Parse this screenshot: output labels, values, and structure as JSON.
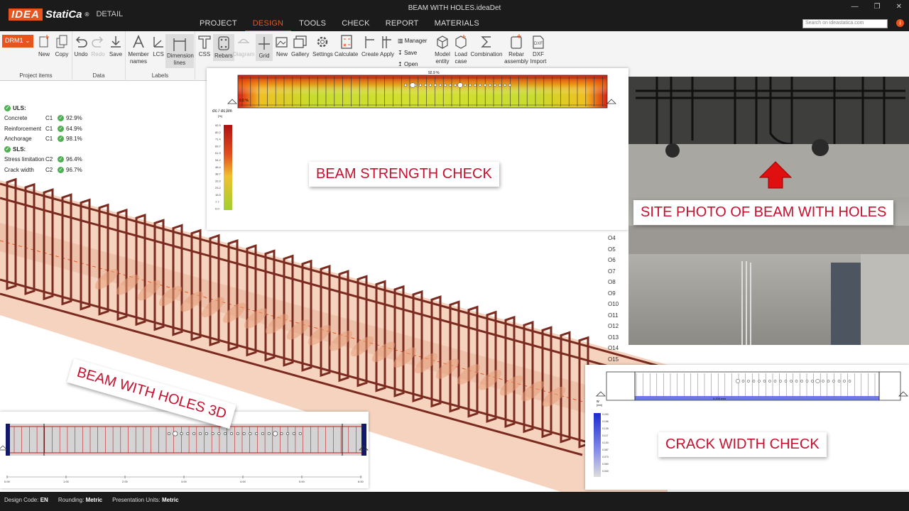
{
  "app": {
    "brand_idea": "IDEA",
    "brand_statica": "StatiCa",
    "brand_reg": "®",
    "product": "DETAIL",
    "window_title": "BEAM WITH HOLES.ideaDet"
  },
  "menu": [
    "PROJECT",
    "DESIGN",
    "TOOLS",
    "CHECK",
    "REPORT",
    "MATERIALS"
  ],
  "search": {
    "placeholder": "Search on ideastatica.com"
  },
  "ribbon": {
    "member": "DRM1",
    "project_items": {
      "label": "Project items",
      "new": "New",
      "copy": "Copy"
    },
    "data": {
      "label": "Data",
      "undo": "Undo",
      "redo": "Redo",
      "save": "Save"
    },
    "labels": {
      "label": "Labels",
      "member_names": "Member names",
      "lcs": "LCS",
      "dimension_lines": "Dimension lines"
    },
    "css": "CSS",
    "rebars": "Rebars",
    "diagram": "Diagram",
    "grid": "Grid",
    "new2": "New",
    "gallery": "Gallery",
    "settings": "Settings",
    "calculate": "Calculate",
    "create": "Create",
    "apply": "Apply",
    "manager": "Manager",
    "save2": "Save",
    "open": "Open",
    "model_entity": "Model entity",
    "load_case": "Load case",
    "combination": "Combination",
    "rebar_assembly": "Rebar assembly",
    "dxf_import": "DXF Import"
  },
  "results": {
    "uls": "ULS:",
    "uls_rows": [
      {
        "name": "Concrete",
        "case": "C1",
        "value": "92.9%"
      },
      {
        "name": "Reinforcement",
        "case": "C1",
        "value": "64.9%"
      },
      {
        "name": "Anchorage",
        "case": "C1",
        "value": "98.1%"
      }
    ],
    "sls": "SLS:",
    "sls_rows": [
      {
        "name": "Stress limitation",
        "case": "C2",
        "value": "96.4%"
      },
      {
        "name": "Crack width",
        "case": "C2",
        "value": "96.7%"
      }
    ]
  },
  "strength_panel": {
    "legend_title": "σc / σc,lim",
    "legend_unit": "[%]",
    "legend_values": [
      "92.9",
      "80.2",
      "71.4",
      "69.7",
      "61.9",
      "54.2",
      "46.4",
      "38.7",
      "31.0",
      "23.2",
      "15.5",
      "7.7",
      "0.0"
    ],
    "max_label": "92.9 %",
    "min_label": "0.0 %"
  },
  "crack_panel": {
    "legend_title": "w",
    "legend_unit": "[mm]",
    "legend_values": [
      "0.200",
      "0.166",
      "0.139",
      "0.117",
      "0.100",
      "0.087",
      "0.073",
      "0.060",
      "0.040"
    ],
    "mid_label": "0.200 mm"
  },
  "side_list": [
    "O4",
    "O5",
    "O6",
    "O7",
    "O8",
    "O9",
    "O10",
    "O11",
    "O12",
    "O13",
    "O14",
    "O15"
  ],
  "bottom_axis": [
    "0.00",
    "1.00",
    "2.00",
    "3.00",
    "4.00",
    "5.00",
    "6.00"
  ],
  "banners": {
    "strength": "BEAM STRENGTH CHECK",
    "site": "SITE PHOTO OF BEAM WITH HOLES",
    "holes3d": "BEAM WITH HOLES 3D",
    "crack": "CRACK WIDTH CHECK"
  },
  "status": {
    "design_code_label": "Design Code:",
    "design_code": "EN",
    "rounding_label": "Rounding:",
    "rounding": "Metric",
    "units_label": "Presentation Units:",
    "units": "Metric"
  }
}
